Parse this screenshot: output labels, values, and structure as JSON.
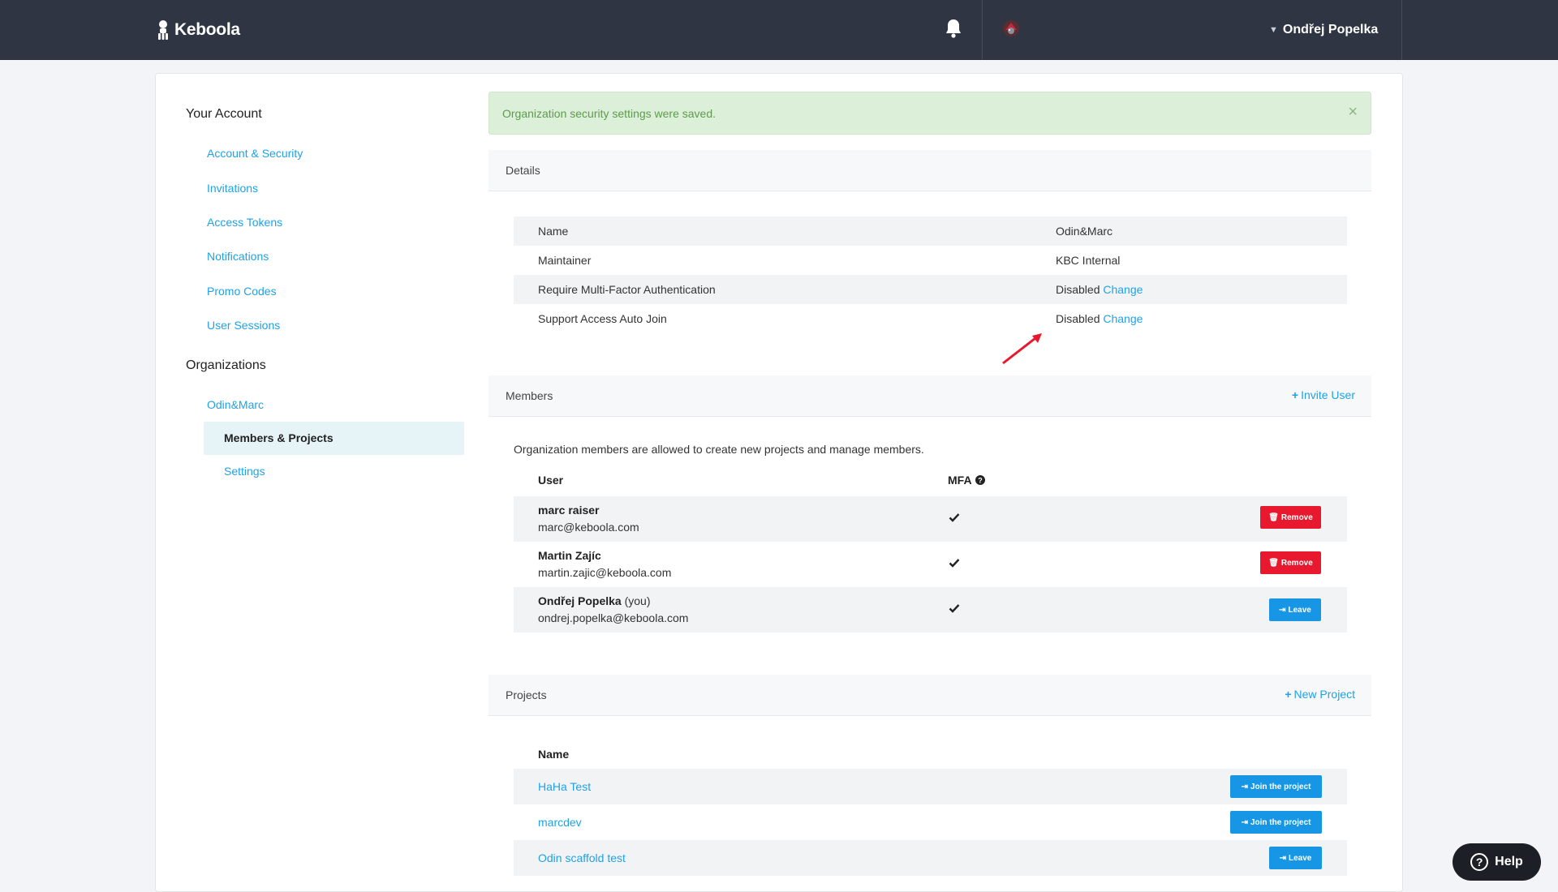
{
  "topbar": {
    "brand": "Keboola",
    "user_name": "Ondřej Popelka"
  },
  "sidebar": {
    "account_heading": "Your Account",
    "account_items": [
      {
        "label": "Account & Security"
      },
      {
        "label": "Invitations"
      },
      {
        "label": "Access Tokens"
      },
      {
        "label": "Notifications"
      },
      {
        "label": "Promo Codes"
      },
      {
        "label": "User Sessions"
      }
    ],
    "org_heading": "Organizations",
    "org_name": "Odin&Marc",
    "org_items": [
      {
        "label": "Members & Projects",
        "active": true
      },
      {
        "label": "Settings"
      }
    ]
  },
  "alert": {
    "message": "Organization security settings were saved.",
    "close": "×"
  },
  "details": {
    "title": "Details",
    "rows": [
      {
        "label": "Name",
        "value": "Odin&Marc"
      },
      {
        "label": "Maintainer",
        "value": "KBC Internal"
      },
      {
        "label": "Require Multi-Factor Authentication",
        "value": "Disabled",
        "action": "Change"
      },
      {
        "label": "Support Access Auto Join",
        "value": "Disabled",
        "action": "Change"
      }
    ]
  },
  "members": {
    "title": "Members",
    "invite_label": "Invite User",
    "description": "Organization members are allowed to create new projects and manage members.",
    "col_user": "User",
    "col_mfa": "MFA",
    "rows": [
      {
        "name": "marc raiser",
        "suffix": "",
        "email": "marc@keboola.com",
        "mfa": true,
        "action": "Remove"
      },
      {
        "name": "Martin Zajíc",
        "suffix": "",
        "email": "martin.zajic@keboola.com",
        "mfa": true,
        "action": "Remove"
      },
      {
        "name": "Ondřej Popelka",
        "suffix": "(you)",
        "email": "ondrej.popelka@keboola.com",
        "mfa": true,
        "action": "Leave"
      }
    ]
  },
  "projects": {
    "title": "Projects",
    "new_label": "New Project",
    "col_name": "Name",
    "rows": [
      {
        "name": "HaHa Test",
        "action": "Join the project"
      },
      {
        "name": "marcdev",
        "action": "Join the project"
      },
      {
        "name": "Odin scaffold test",
        "action": "Leave"
      }
    ]
  },
  "help": {
    "label": "Help"
  },
  "colors": {
    "topbar": "#2f3542",
    "accent": "#1fa2e6",
    "danger": "#e8192e",
    "primary_button": "#1796e6",
    "success_bg": "#dcefd8"
  }
}
